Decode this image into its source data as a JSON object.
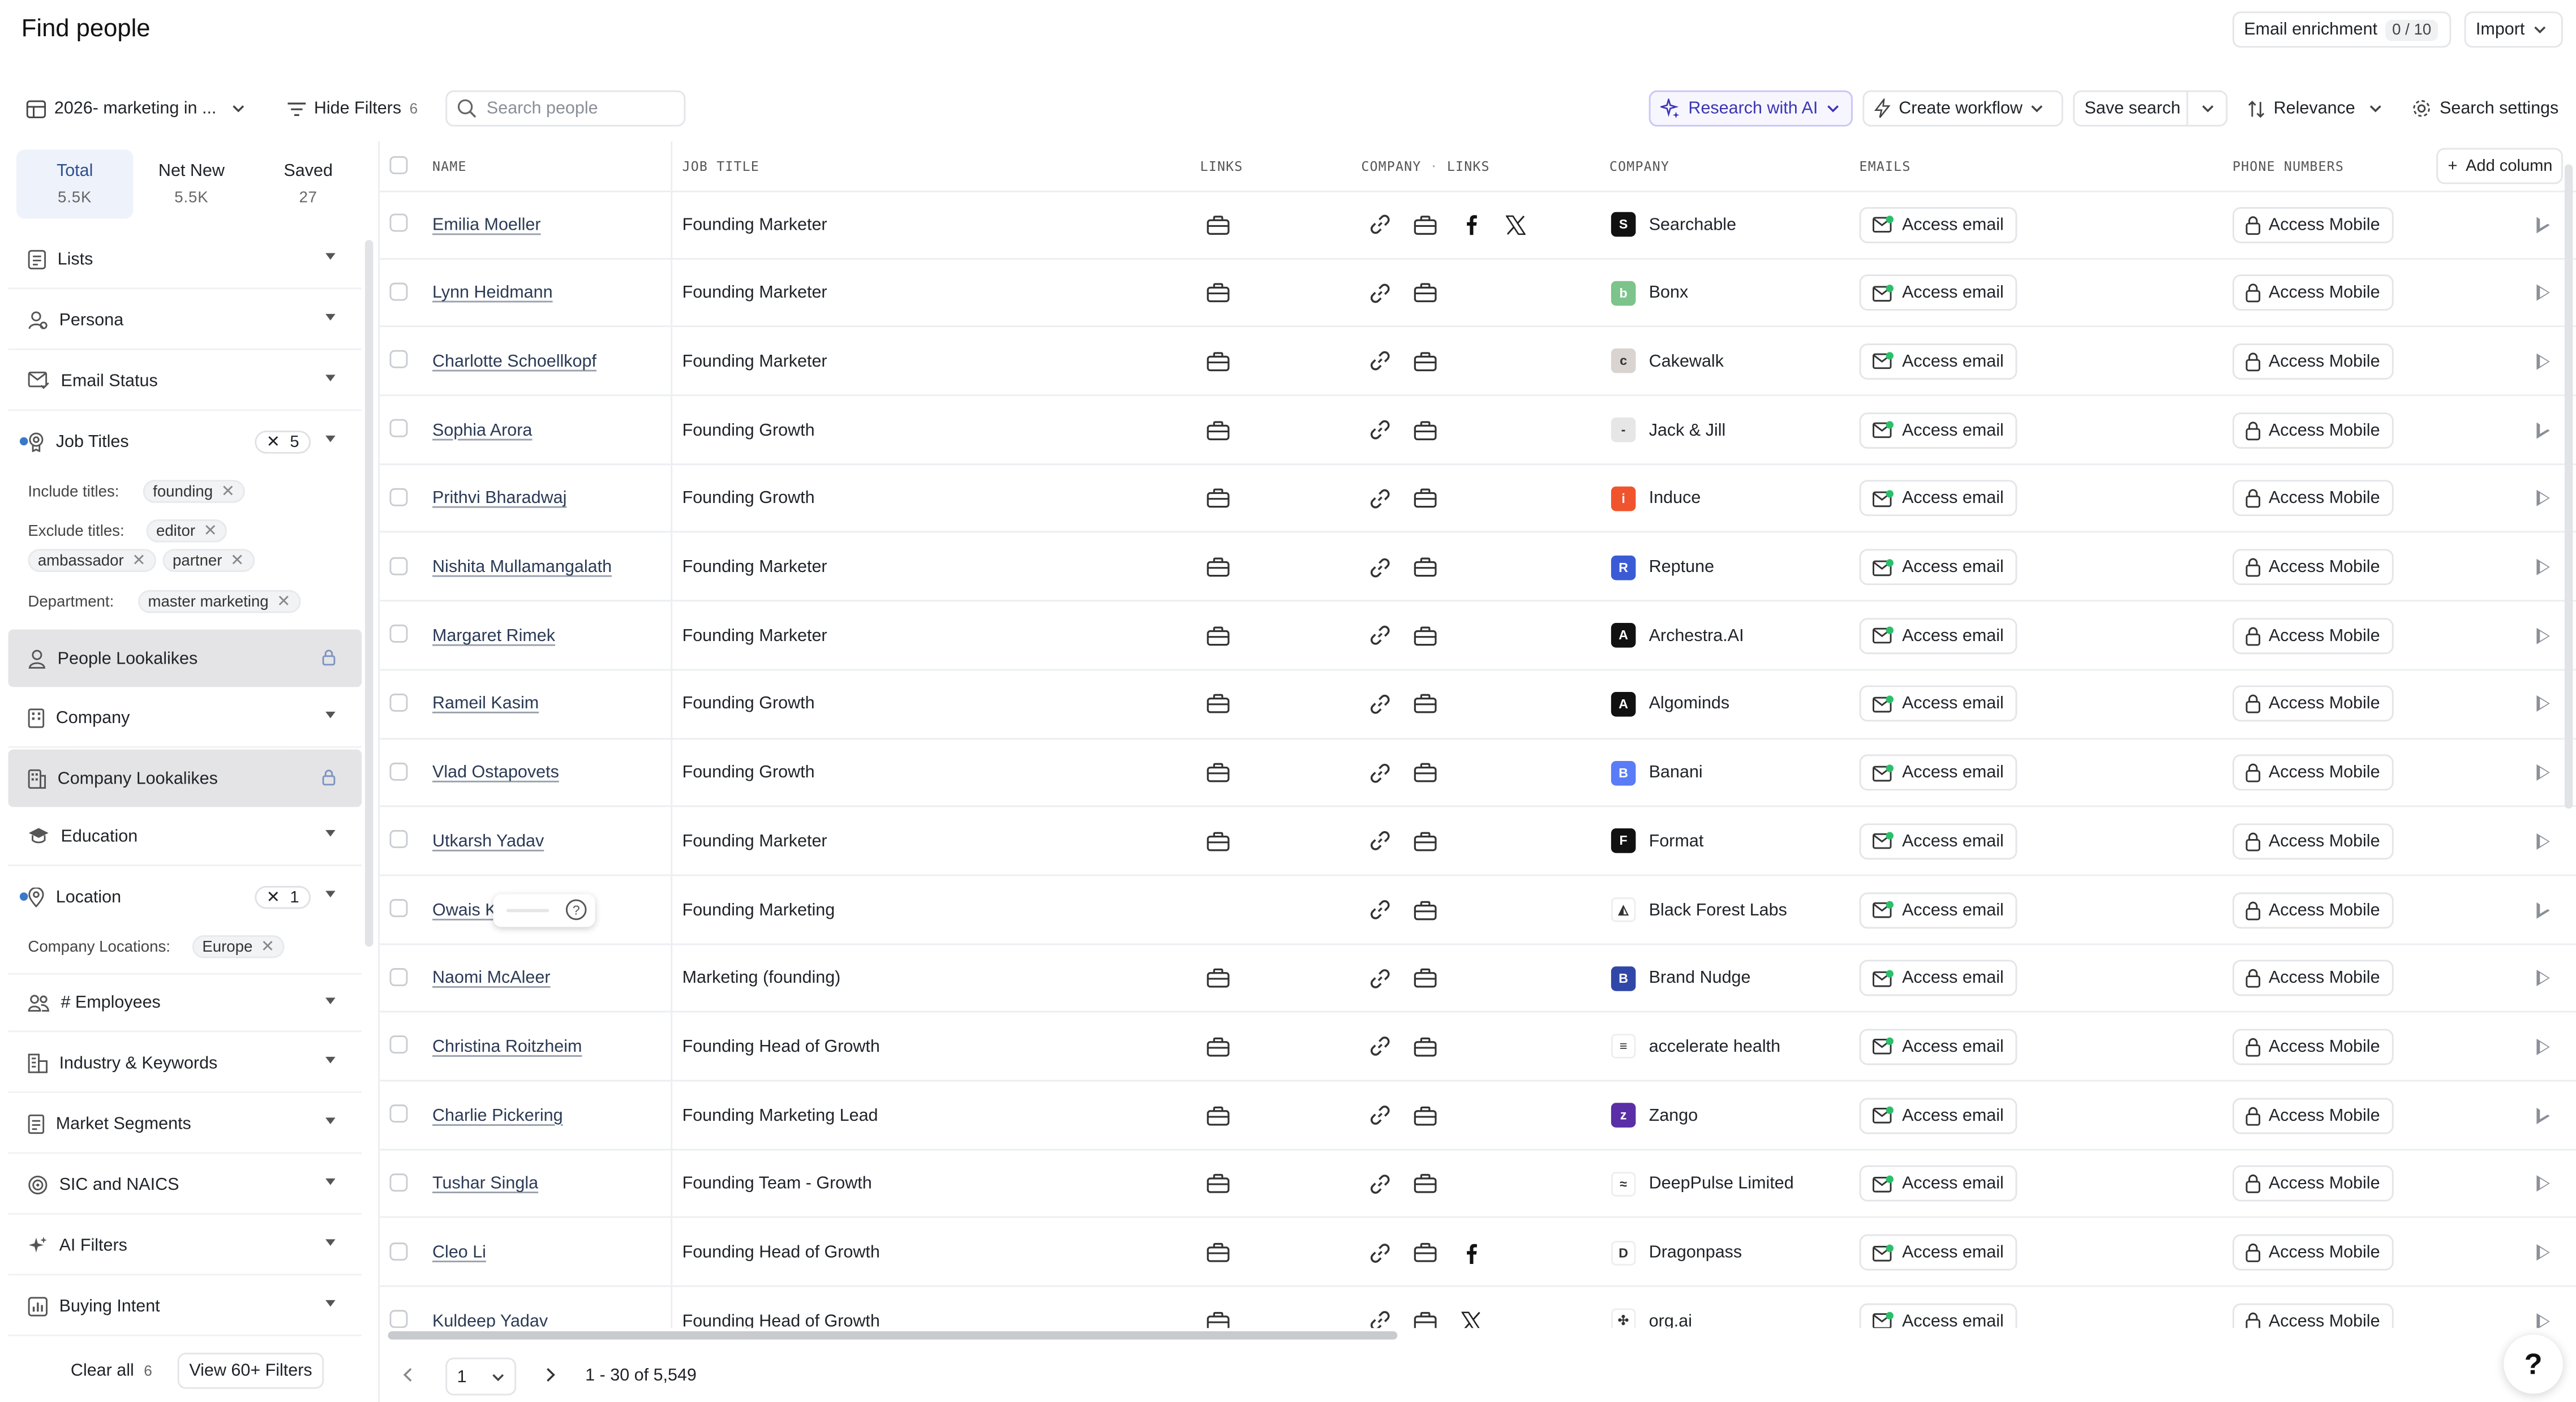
{
  "header": {
    "title": "Find people",
    "email_enrichment_label": "Email enrichment",
    "email_enrichment_count": "0 / 10",
    "import_label": "Import"
  },
  "toolbar": {
    "view_name": "2026- marketing in ...",
    "hide_filters_label": "Hide Filters",
    "hide_filters_count": "6",
    "search_placeholder": "Search people",
    "research_ai_label": "Research with AI",
    "create_workflow_label": "Create workflow",
    "save_search_label": "Save search",
    "relevance_label": "Relevance",
    "search_settings_label": "Search settings"
  },
  "stats": [
    {
      "label": "Total",
      "value": "5.5K"
    },
    {
      "label": "Net New",
      "value": "5.5K"
    },
    {
      "label": "Saved",
      "value": "27"
    }
  ],
  "filters": {
    "lists": "Lists",
    "persona": "Persona",
    "email_status": "Email Status",
    "job_titles": "Job Titles",
    "job_titles_count": "5",
    "include_titles_label": "Include titles:",
    "include_titles": [
      "founding"
    ],
    "exclude_titles_label": "Exclude titles:",
    "exclude_titles": [
      "editor",
      "ambassador",
      "partner"
    ],
    "department_label": "Department:",
    "departments": [
      "master marketing"
    ],
    "people_lookalikes": "People Lookalikes",
    "company": "Company",
    "company_lookalikes": "Company Lookalikes",
    "education": "Education",
    "location": "Location",
    "location_count": "1",
    "company_locations_label": "Company Locations:",
    "company_locations": [
      "Europe"
    ],
    "employees": "# Employees",
    "industry": "Industry & Keywords",
    "market_segments": "Market Segments",
    "sic": "SIC and NAICS",
    "ai_filters": "AI Filters",
    "buying_intent": "Buying Intent",
    "clear_all_label": "Clear all",
    "clear_all_count": "6",
    "view_more_label": "View 60+ Filters"
  },
  "table": {
    "columns": {
      "name": "NAME",
      "job_title": "JOB TITLE",
      "links": "LINKS",
      "company_links_a": "COMPANY",
      "company_links_sep": "·",
      "company_links_b": "LINKS",
      "company": "COMPANY",
      "emails": "EMAILS",
      "phone": "PHONE NUMBERS",
      "add_column": "Add column"
    },
    "access_email_label": "Access email",
    "access_mobile_label": "Access Mobile",
    "rows": [
      {
        "name": "Emilia Moeller",
        "title": "Founding Marketer",
        "company": "Searchable",
        "logo_color": "#111111",
        "logo_glyph": "S",
        "facebook": true,
        "x": true,
        "person_link": true
      },
      {
        "name": "Lynn Heidmann",
        "title": "Founding Marketer",
        "company": "Bonx",
        "logo_color": "#7cc48b",
        "logo_glyph": "b",
        "facebook": false,
        "x": false,
        "person_link": true
      },
      {
        "name": "Charlotte Schoellkopf",
        "title": "Founding Marketer",
        "company": "Cakewalk",
        "logo_color": "#d9d4cf",
        "logo_glyph": "c",
        "facebook": false,
        "x": false,
        "person_link": true
      },
      {
        "name": "Sophia Arora",
        "title": "Founding Growth",
        "company": "Jack & Jill",
        "logo_color": "#e6e6e6",
        "logo_glyph": "-",
        "facebook": false,
        "x": false,
        "person_link": true
      },
      {
        "name": "Prithvi Bharadwaj",
        "title": "Founding Growth",
        "company": "Induce",
        "logo_color": "#f0542d",
        "logo_glyph": "i",
        "facebook": false,
        "x": false,
        "person_link": true
      },
      {
        "name": "Nishita Mullamangalath",
        "title": "Founding Marketer",
        "company": "Reptune",
        "logo_color": "#3b5bd6",
        "logo_glyph": "R",
        "facebook": false,
        "x": false,
        "person_link": true
      },
      {
        "name": "Margaret Rimek",
        "title": "Founding Marketer",
        "company": "Archestra.AI",
        "logo_color": "#111111",
        "logo_glyph": "A",
        "facebook": false,
        "x": false,
        "person_link": true
      },
      {
        "name": "Rameil Kasim",
        "title": "Founding Growth",
        "company": "Algominds",
        "logo_color": "#111111",
        "logo_glyph": "A",
        "facebook": false,
        "x": false,
        "person_link": true
      },
      {
        "name": "Vlad Ostapovets",
        "title": "Founding Growth",
        "company": "Banani",
        "logo_color": "#5b7cf7",
        "logo_glyph": "B",
        "facebook": false,
        "x": false,
        "person_link": true
      },
      {
        "name": "Utkarsh Yadav",
        "title": "Founding Marketer",
        "company": "Format",
        "logo_color": "#111111",
        "logo_glyph": "F",
        "facebook": false,
        "x": false,
        "person_link": true
      },
      {
        "name": "Owais K",
        "title": "Founding Marketing",
        "company": "Black Forest Labs",
        "logo_color": "#ffffff",
        "logo_glyph": "◭",
        "facebook": false,
        "x": false,
        "person_link": false
      },
      {
        "name": "Naomi McAleer",
        "title": "Marketing (founding)",
        "company": "Brand Nudge",
        "logo_color": "#3147a8",
        "logo_glyph": "B",
        "facebook": false,
        "x": false,
        "person_link": true
      },
      {
        "name": "Christina Roitzheim",
        "title": "Founding Head of Growth",
        "company": "accelerate health",
        "logo_color": "#ffffff",
        "logo_glyph": "≡",
        "facebook": false,
        "x": false,
        "person_link": true
      },
      {
        "name": "Charlie Pickering",
        "title": "Founding Marketing Lead",
        "company": "Zango",
        "logo_color": "#5a2ea6",
        "logo_glyph": "z",
        "facebook": false,
        "x": false,
        "person_link": true
      },
      {
        "name": "Tushar Singla",
        "title": "Founding Team - Growth",
        "company": "DeepPulse Limited",
        "logo_color": "#ffffff",
        "logo_glyph": "≈",
        "facebook": false,
        "x": false,
        "person_link": true
      },
      {
        "name": "Cleo Li",
        "title": "Founding Head of Growth",
        "company": "Dragonpass",
        "logo_color": "#ffffff",
        "logo_glyph": "D",
        "facebook": true,
        "x": false,
        "person_link": true
      },
      {
        "name": "Kuldeep Yadav",
        "title": "Founding Head of Growth",
        "company": "org.ai",
        "logo_color": "#ffffff",
        "logo_glyph": "✣",
        "facebook": false,
        "x": true,
        "person_link": true
      }
    ]
  },
  "pager": {
    "page": "1",
    "range": "1 - 30 of 5,549"
  },
  "help_label": "?"
}
